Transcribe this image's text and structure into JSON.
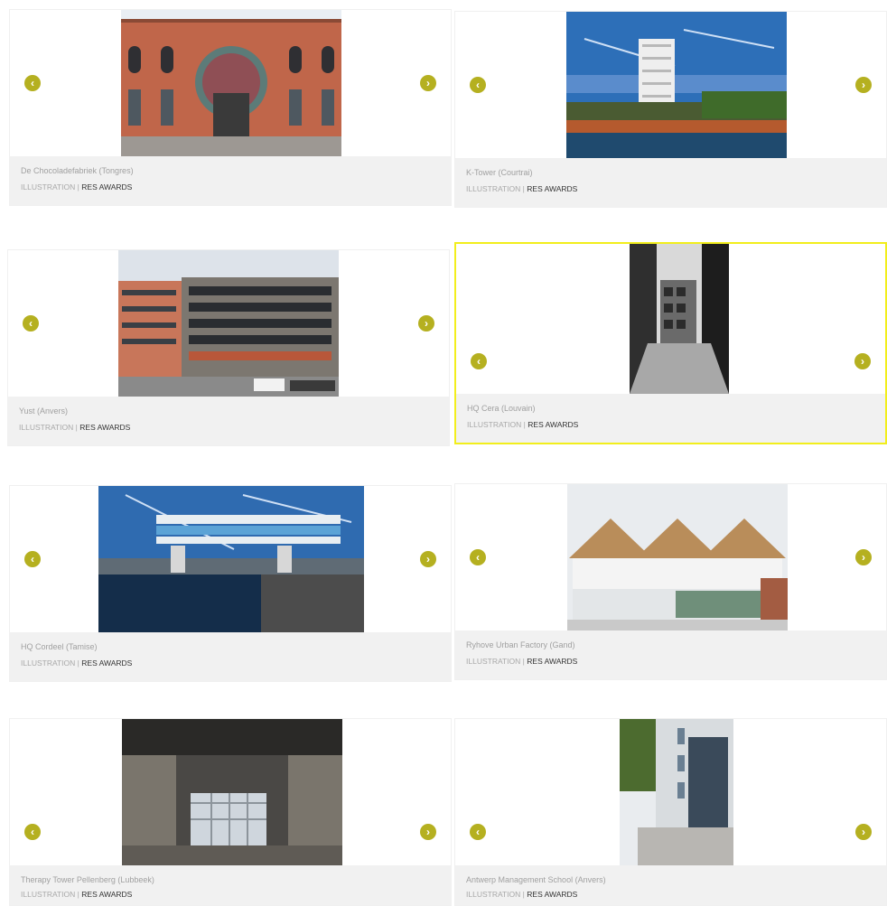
{
  "colors": {
    "accent": "#b5b020",
    "selected_border": "#f2ee1c",
    "caption_bg": "#f1f1f1"
  },
  "arrows": {
    "prev": "‹",
    "next": "›"
  },
  "separator": "|",
  "projects": [
    {
      "title": "De Chocoladefabriek (Tongres)",
      "category": "ILLUSTRATION",
      "tag": "RES AWARDS",
      "image": "brick-factory-facade"
    },
    {
      "title": "K-Tower (Courtrai)",
      "category": "ILLUSTRATION",
      "tag": "RES AWARDS",
      "image": "white-tower-by-water"
    },
    {
      "title": "Yust (Anvers)",
      "category": "ILLUSTRATION",
      "tag": "RES AWARDS",
      "image": "grid-facade-building"
    },
    {
      "title": "HQ Cera (Louvain)",
      "category": "ILLUSTRATION",
      "tag": "RES AWARDS",
      "image": "black-white-street"
    },
    {
      "title": "HQ Cordeel (Tamise)",
      "category": "ILLUSTRATION",
      "tag": "RES AWARDS",
      "image": "cantilever-building-dock"
    },
    {
      "title": "Ryhove Urban Factory (Gand)",
      "category": "ILLUSTRATION",
      "tag": "RES AWARDS",
      "image": "sawtooth-roof-building"
    },
    {
      "title": "Therapy Tower Pellenberg (Lubbeek)",
      "category": "ILLUSTRATION",
      "tag": "RES AWARDS",
      "image": "concrete-hall-interior"
    },
    {
      "title": "Antwerp Management School (Anvers)",
      "category": "ILLUSTRATION",
      "tag": "RES AWARDS",
      "image": "white-facade-street"
    }
  ]
}
